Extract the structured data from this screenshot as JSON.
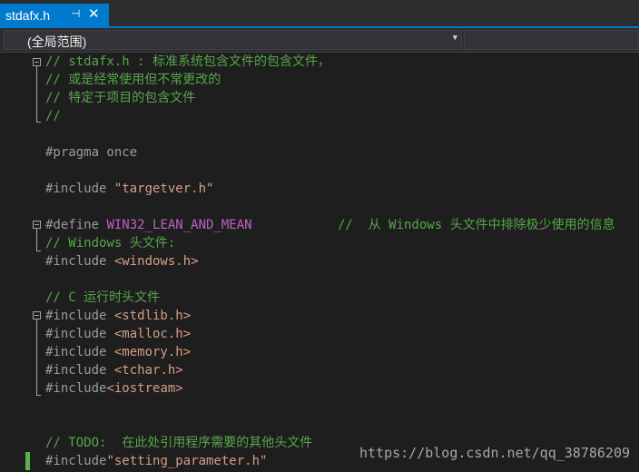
{
  "tab": {
    "title": "stdafx.h",
    "pin_glyph": "⊣",
    "close_glyph": "✕"
  },
  "nav": {
    "scope": "(全局范围)",
    "dropdown_glyph": "▼"
  },
  "code_lines": [
    "// stdafx.h : 标准系统包含文件的包含文件，",
    "// 或是经常使用但不常更改的",
    "// 特定于项目的包含文件",
    "//",
    "#pragma once",
    "#include ",
    "\"targetver.h\"",
    "#define ",
    "WIN32_LEAN_AND_MEAN",
    "//  从 Windows 头文件中排除极少使用的信息",
    "// Windows 头文件:",
    "#include ",
    "<windows.h>",
    "// C 运行时头文件",
    "#include ",
    "<stdlib.h>",
    "#include ",
    "<malloc.h>",
    "#include ",
    "<memory.h>",
    "#include ",
    "<tchar.h>",
    "#include",
    "<iostream>",
    "// TODO:  在此处引用程序需要的其他头文件",
    "#include",
    "\"setting_parameter.h\""
  ],
  "watermark": "https://blog.csdn.net/qq_38786209"
}
